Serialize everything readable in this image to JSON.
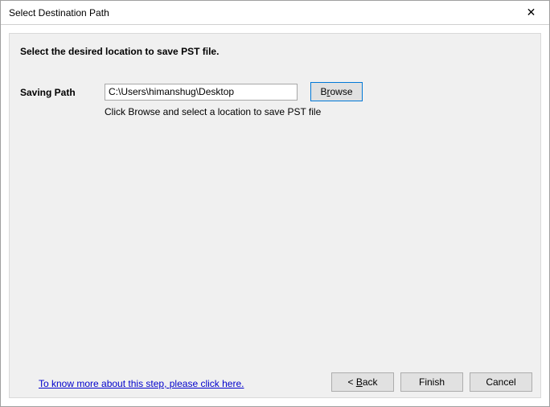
{
  "window": {
    "title": "Select Destination Path"
  },
  "main": {
    "instruction": "Select the desired location to save PST file.",
    "path_label": "Saving Path",
    "path_value": "C:\\Users\\himanshug\\Desktop",
    "browse_pre": "B",
    "browse_u": "r",
    "browse_post": "owse",
    "hint": "Click Browse and select a location to save PST file",
    "help_link": "To know more about this step, please click here."
  },
  "buttons": {
    "back_pre": "< ",
    "back_u": "B",
    "back_post": "ack",
    "finish": "Finish",
    "cancel": "Cancel"
  }
}
